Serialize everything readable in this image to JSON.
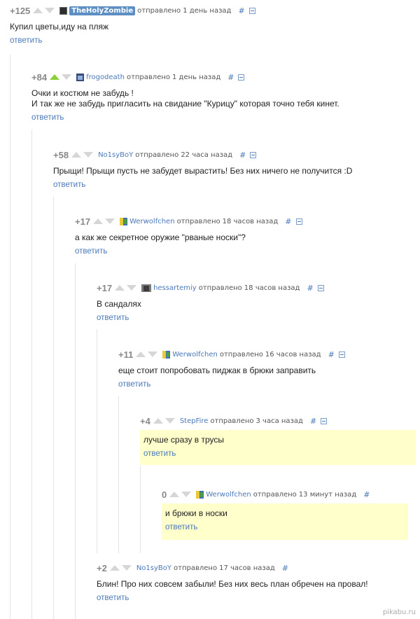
{
  "meta_labels": {
    "sent": "отправлено",
    "hash": "#",
    "reply": "ответить"
  },
  "comments": [
    {
      "rating": "+125",
      "author": "TheHolyZombie",
      "time": "1 день назад",
      "text": "Купил цветы,иду на пляж"
    },
    {
      "rating": "+84",
      "author": "frogodeath",
      "time": "1 день назад",
      "text": "Очки и костюм не забудь !\nИ так же не забудь пригласить на свидание \"Курицу\" которая точно тебя кинет."
    },
    {
      "rating": "+58",
      "author": "No1syBoY",
      "time": "22 часа назад",
      "text": "Прыщи! Прыщи пусть не забудет вырастить! Без них ничего не получится :D"
    },
    {
      "rating": "+17",
      "author": "Werwolfchen",
      "time": "18 часов назад",
      "text": "а как же секретное оружие \"рваные носки\"?"
    },
    {
      "rating": "+17",
      "author": "hessartemiy",
      "time": "18 часов назад",
      "text": "В сандалях"
    },
    {
      "rating": "+11",
      "author": "Werwolfchen",
      "time": "16 часов назад",
      "text": "еще стоит попробовать пиджак в брюки заправить"
    },
    {
      "rating": "+4",
      "author": "StepFire",
      "time": "3 часа назад",
      "text": "лучше сразу в трусы"
    },
    {
      "rating": "0",
      "author": "Werwolfchen",
      "time": "13 минут назад",
      "text": "и брюки в носки"
    },
    {
      "rating": "+2",
      "author": "No1syBoY",
      "time": "17 часов назад",
      "text": "Блин! Про них совсем забыли! Без них весь план обречен на провал!"
    }
  ],
  "watermark": "pikabu.ru",
  "colors": {
    "link": "#4b79b8",
    "highlight": "#ffffcc",
    "upvoted": "#8ccf3c"
  }
}
